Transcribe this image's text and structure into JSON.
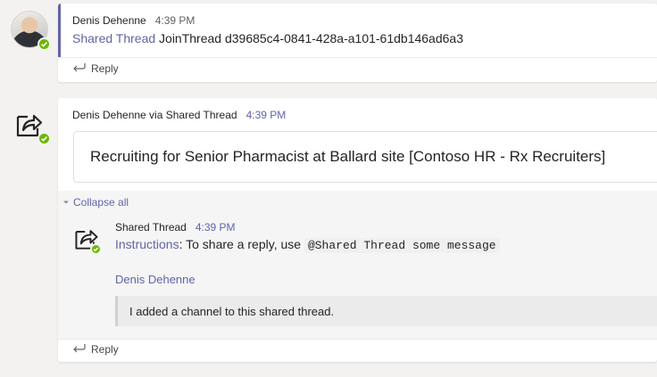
{
  "post1": {
    "author": "Denis Dehenne",
    "time": "4:39 PM",
    "link_text": "Shared Thread",
    "message": "JoinThread d39685c4-0841-428a-a101-61db146ad6a3",
    "reply_label": "Reply"
  },
  "post2": {
    "author": "Denis Dehenne via Shared Thread",
    "time": "4:39 PM",
    "title": "Recruiting for Senior Pharmacist at Ballard site [Contoso HR - Rx Recruiters]",
    "collapse_label": "Collapse all",
    "inner": {
      "author": "Shared Thread",
      "time": "4:39 PM",
      "link_text": "Instructions",
      "text_before_code": ": To share a reply, use ",
      "code": "@Shared Thread some message"
    },
    "nested": {
      "author_link": "Denis Dehenne",
      "quote": "I added a channel to this shared thread."
    },
    "reply_label": "Reply"
  },
  "colors": {
    "accent": "#6264a7",
    "presence": "#6bb700",
    "background": "#f3f2f1"
  },
  "icons": [
    "user-avatar",
    "share-thread-icon",
    "reply-arrow-icon",
    "chevron-down-icon",
    "presence-available-icon"
  ]
}
